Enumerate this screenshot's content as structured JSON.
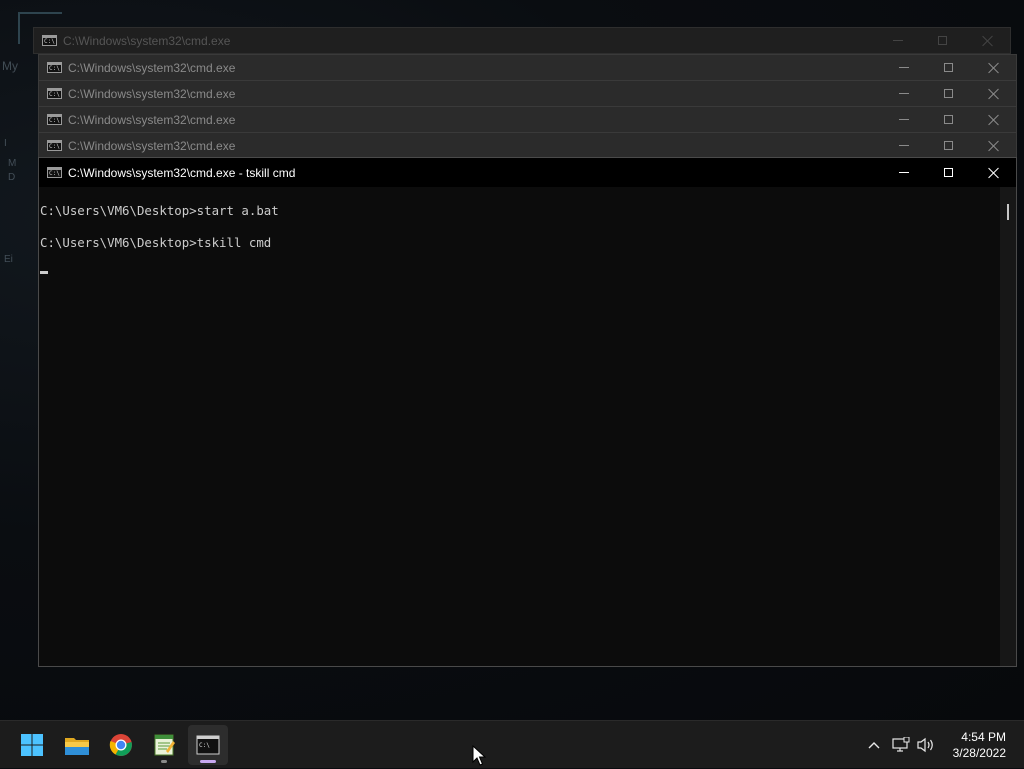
{
  "desktop": {
    "fragments": [
      "My",
      "▄",
      "I",
      "M",
      "D",
      "I",
      "Ei"
    ]
  },
  "windows": {
    "ghost_title": "C:\\Windows\\system32\\cmd.exe",
    "stack": [
      {
        "title": "C:\\Windows\\system32\\cmd.exe"
      },
      {
        "title": "C:\\Windows\\system32\\cmd.exe"
      },
      {
        "title": "C:\\Windows\\system32\\cmd.exe"
      },
      {
        "title": "C:\\Windows\\system32\\cmd.exe"
      }
    ],
    "active": {
      "title": "C:\\Windows\\system32\\cmd.exe - tskill  cmd",
      "lines": [
        "C:\\Users\\VM6\\Desktop>start a.bat",
        "",
        "C:\\Users\\VM6\\Desktop>tskill cmd"
      ]
    }
  },
  "taskbar": {
    "apps": [
      "windows-start",
      "file-explorer",
      "chrome",
      "notepad-app",
      "terminal"
    ],
    "clock": {
      "time": "4:54 PM",
      "date": "3/28/2022"
    }
  },
  "colors": {
    "console_bg": "#0c0c0c",
    "console_text": "#cccccc",
    "taskbar_bg": "#1c1c1c",
    "accent_start": "#4cc2ff",
    "active_indicator": "#c8a8f0"
  }
}
